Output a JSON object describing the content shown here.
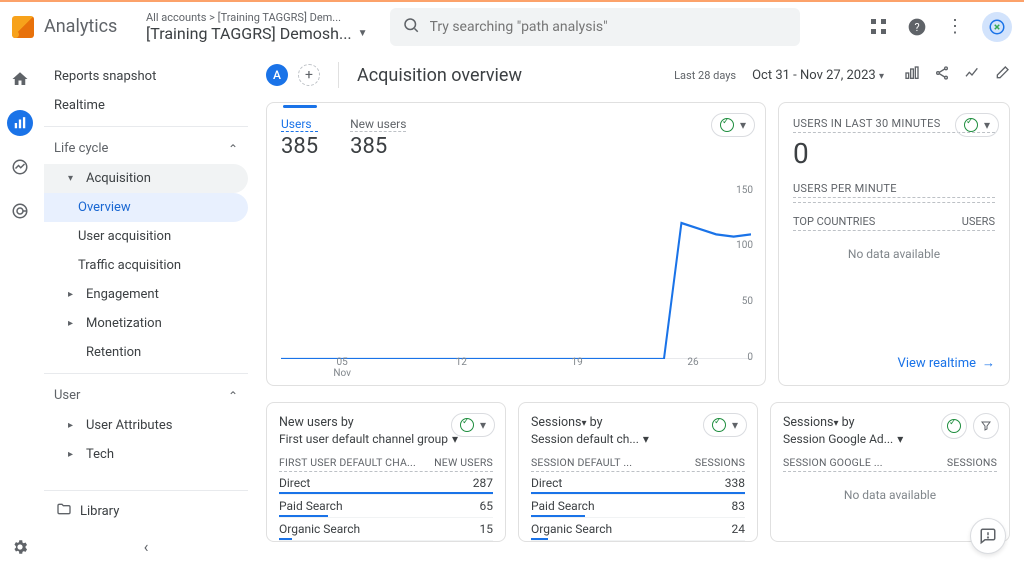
{
  "header": {
    "logo": "Analytics",
    "breadcrumb": "All accounts > [Training TAGGRS] Dem...",
    "property": "[Training TAGGRS] Demosh...",
    "search_placeholder": "Try searching \"path analysis\""
  },
  "sidebar": {
    "snapshot": "Reports snapshot",
    "realtime": "Realtime",
    "lifecycle": "Life cycle",
    "acquisition": "Acquisition",
    "overview": "Overview",
    "user_acq": "User acquisition",
    "traffic_acq": "Traffic acquisition",
    "engagement": "Engagement",
    "monetization": "Monetization",
    "retention": "Retention",
    "user": "User",
    "user_attrs": "User Attributes",
    "tech": "Tech",
    "library": "Library"
  },
  "main": {
    "title": "Acquisition overview",
    "date_label": "Last 28 days",
    "date_range": "Oct 31 - Nov 27, 2023",
    "users_label": "Users",
    "users_value": "385",
    "newusers_label": "New users",
    "newusers_value": "385"
  },
  "realtime": {
    "title": "USERS IN LAST 30 MINUTES",
    "value": "0",
    "upm": "USERS PER MINUTE",
    "col1": "TOP COUNTRIES",
    "col2": "USERS",
    "nodata": "No data available",
    "link": "View realtime"
  },
  "cards": {
    "c1": {
      "t1": "New users",
      "by": "by",
      "t2": "First user default channel group",
      "h1": "FIRST USER DEFAULT CHA...",
      "h2": "NEW USERS"
    },
    "c2": {
      "t1": "Sessions",
      "by": "by",
      "t2": "Session default ch...",
      "h1": "SESSION DEFAULT ...",
      "h2": "SESSIONS"
    },
    "c3": {
      "t1": "Sessions",
      "by": "by",
      "t2": "Session Google Ad...",
      "h1": "SESSION GOOGLE ...",
      "h2": "SESSIONS",
      "nodata": "No data available"
    }
  },
  "chart_data": {
    "type": "line",
    "x": [
      "Oct 31",
      "Nov 01",
      "Nov 02",
      "Nov 03",
      "Nov 04",
      "Nov 05",
      "Nov 06",
      "Nov 07",
      "Nov 08",
      "Nov 09",
      "Nov 10",
      "Nov 11",
      "Nov 12",
      "Nov 13",
      "Nov 14",
      "Nov 15",
      "Nov 16",
      "Nov 17",
      "Nov 18",
      "Nov 19",
      "Nov 20",
      "Nov 21",
      "Nov 22",
      "Nov 23",
      "Nov 24",
      "Nov 25",
      "Nov 26",
      "Nov 27"
    ],
    "x_ticks": [
      "05",
      "12",
      "19",
      "26"
    ],
    "x_sublabel": "Nov",
    "series": [
      {
        "name": "Users",
        "values": [
          0,
          0,
          0,
          0,
          0,
          0,
          0,
          0,
          0,
          0,
          0,
          0,
          0,
          0,
          0,
          0,
          0,
          0,
          0,
          0,
          0,
          0,
          0,
          120,
          115,
          110,
          108,
          110
        ]
      }
    ],
    "ylim": [
      0,
      150
    ],
    "y_ticks": [
      0,
      50,
      100,
      150
    ],
    "xlabel": "",
    "ylabel": ""
  },
  "table1": [
    {
      "label": "Direct",
      "value": 287,
      "bar": 100
    },
    {
      "label": "Paid Search",
      "value": 65,
      "bar": 23
    },
    {
      "label": "Organic Search",
      "value": 15,
      "bar": 6
    }
  ],
  "table2": [
    {
      "label": "Direct",
      "value": 338,
      "bar": 100
    },
    {
      "label": "Paid Search",
      "value": 83,
      "bar": 25
    },
    {
      "label": "Organic Search",
      "value": 24,
      "bar": 8
    }
  ]
}
